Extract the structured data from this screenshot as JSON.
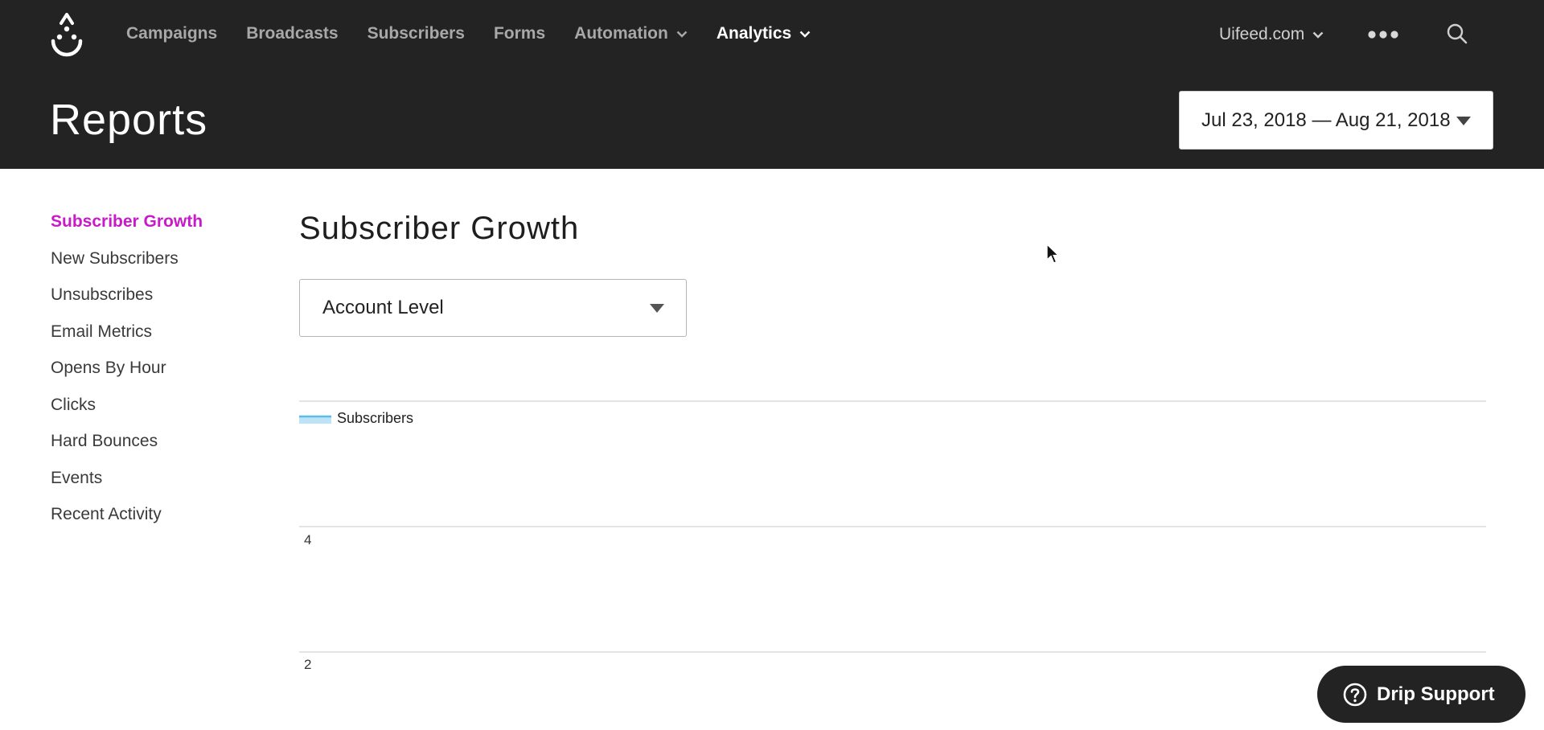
{
  "nav": {
    "items": [
      {
        "label": "Campaigns",
        "active": false,
        "has_dropdown": false
      },
      {
        "label": "Broadcasts",
        "active": false,
        "has_dropdown": false
      },
      {
        "label": "Subscribers",
        "active": false,
        "has_dropdown": false
      },
      {
        "label": "Forms",
        "active": false,
        "has_dropdown": false
      },
      {
        "label": "Automation",
        "active": false,
        "has_dropdown": true
      },
      {
        "label": "Analytics",
        "active": true,
        "has_dropdown": true
      }
    ],
    "account": "Uifeed.com"
  },
  "header": {
    "title": "Reports",
    "date_range": "Jul 23, 2018 — Aug 21, 2018"
  },
  "sidebar": {
    "items": [
      {
        "label": "Subscriber Growth",
        "active": true
      },
      {
        "label": "New Subscribers",
        "active": false
      },
      {
        "label": "Unsubscribes",
        "active": false
      },
      {
        "label": "Email Metrics",
        "active": false
      },
      {
        "label": "Opens By Hour",
        "active": false
      },
      {
        "label": "Clicks",
        "active": false
      },
      {
        "label": "Hard Bounces",
        "active": false
      },
      {
        "label": "Events",
        "active": false
      },
      {
        "label": "Recent Activity",
        "active": false
      }
    ]
  },
  "main": {
    "title": "Subscriber Growth",
    "level_select": "Account Level"
  },
  "chart_data": {
    "type": "line",
    "series": [
      {
        "name": "Subscribers",
        "values": []
      }
    ],
    "y_ticks": [
      "4",
      "2"
    ],
    "grid": true,
    "legend": "top-left",
    "series_color": "#5bbde8"
  },
  "support": {
    "label": "Drip Support"
  },
  "colors": {
    "header_bg": "#232323",
    "accent": "#c81ac8",
    "nav_inactive": "#a8a8a8"
  },
  "icons": {
    "logo": "drip-logo-icon",
    "more": "more-dots-icon",
    "search": "search-icon",
    "help": "question-circle-icon"
  }
}
